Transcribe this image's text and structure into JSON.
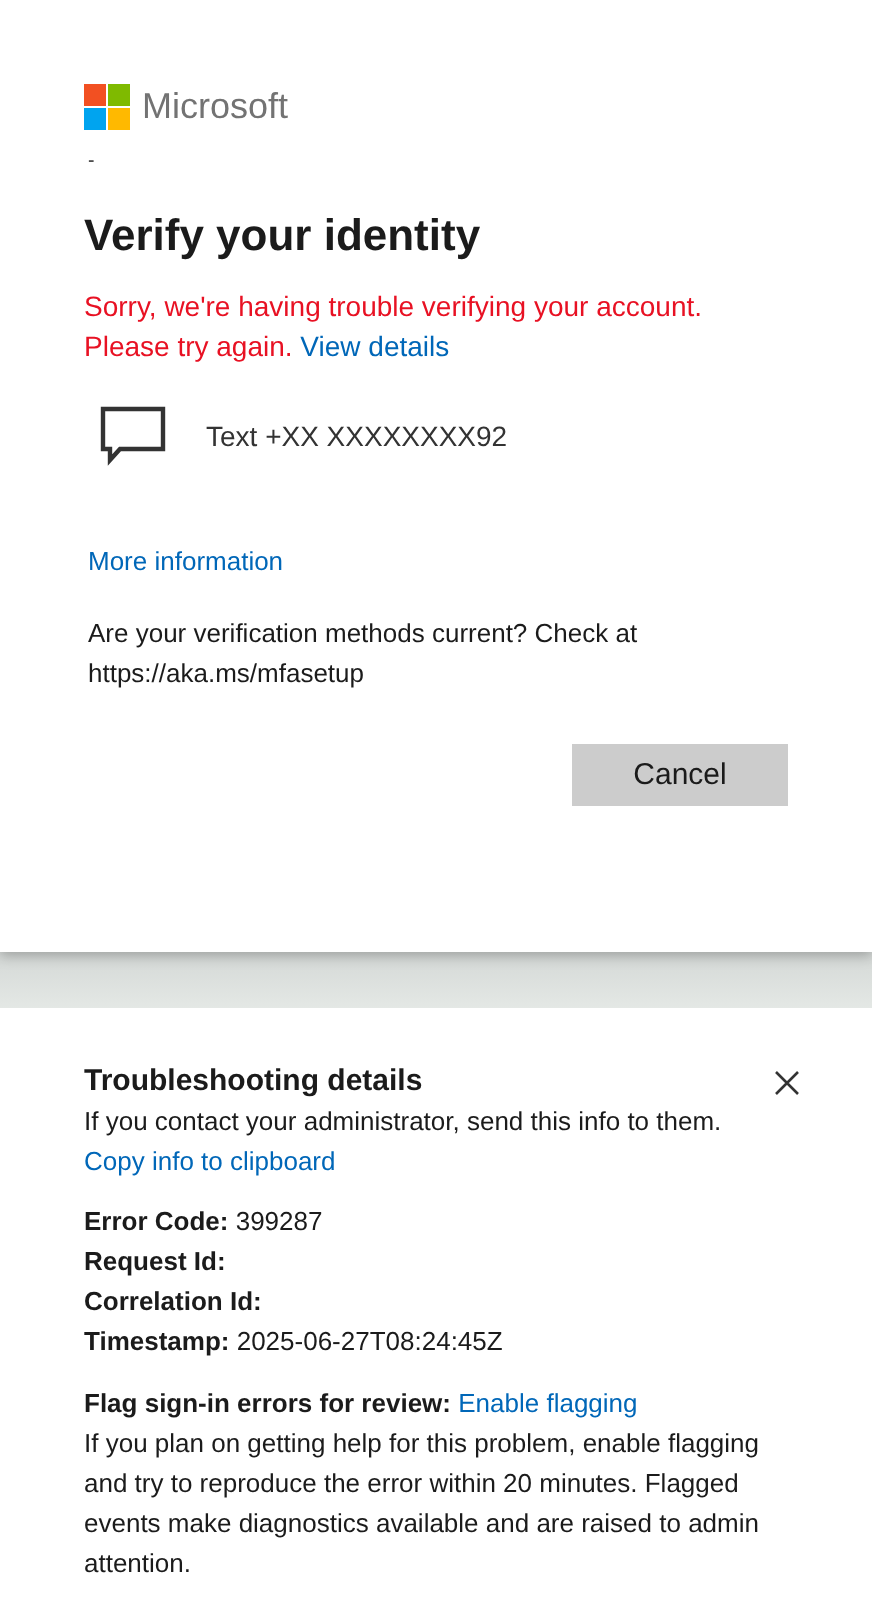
{
  "brand": {
    "name": "Microsoft"
  },
  "account_hint": "-",
  "title": "Verify your identity",
  "error": {
    "message": "Sorry, we're having trouble verifying your account. Please try again.",
    "link": "View details"
  },
  "methods": [
    {
      "kind": "sms",
      "label": "Text +XX XXXXXXXX92"
    }
  ],
  "more_info": "More information",
  "check_note": "Are your verification methods current? Check at https://aka.ms/mfasetup",
  "buttons": [
    "Cancel"
  ],
  "troubleshooting": {
    "title": "Troubleshooting details",
    "intro": "If you contact your administrator, send this info to them.",
    "copy_link": "Copy info to clipboard",
    "fields": [
      {
        "label": "Error Code:",
        "value": "399287"
      },
      {
        "label": "Request Id:"
      },
      {
        "label": "Correlation Id:"
      },
      {
        "label": "Timestamp:",
        "value": "2025-06-27T08:24:45Z"
      }
    ],
    "flag_label": "Flag sign-in errors for review:",
    "flag_link": "Enable flagging",
    "flag_note": "If you plan on getting help for this problem, enable flagging and try to reproduce the error within 20 minutes. Flagged events make diagnostics available and are raised to admin attention."
  }
}
